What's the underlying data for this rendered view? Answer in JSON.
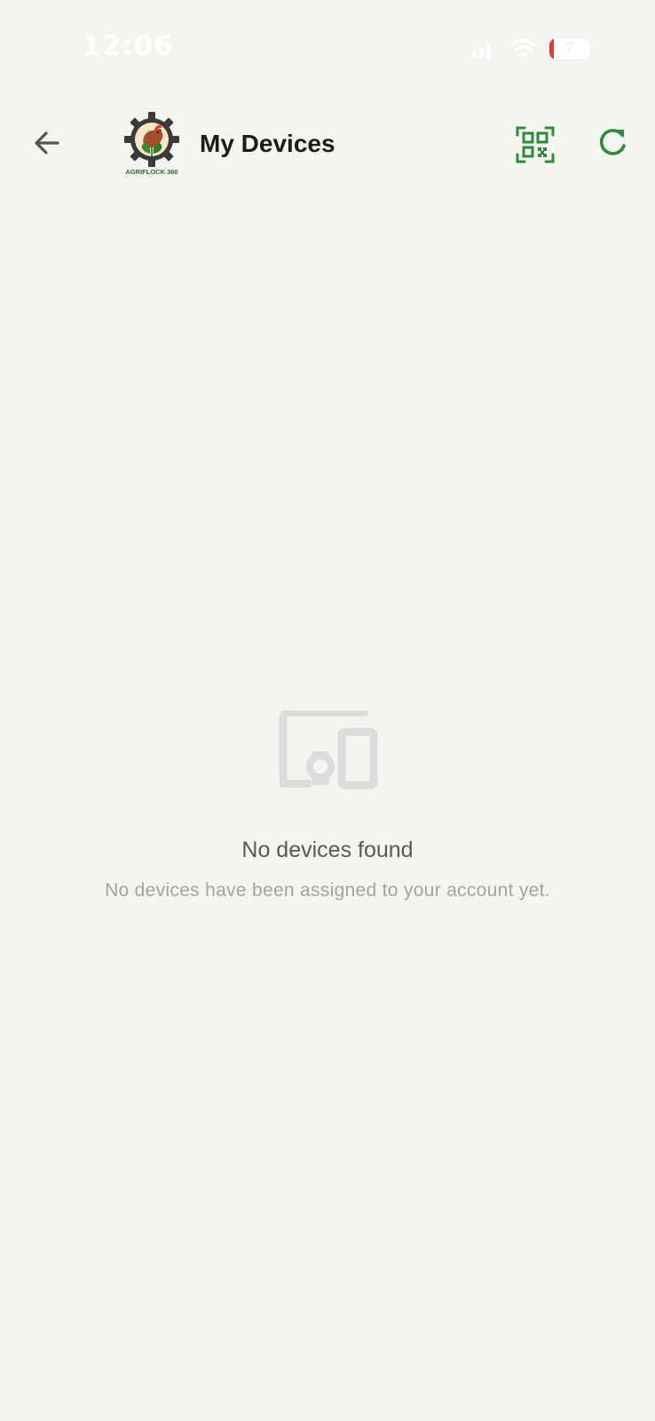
{
  "status_bar": {
    "time": "12:06",
    "battery_level": "7",
    "icons": [
      "signal-icon",
      "wifi-icon",
      "battery-icon"
    ]
  },
  "header": {
    "title": "My Devices",
    "logo_text": "AGRIFLOCK 360",
    "icons": [
      "back-arrow-icon",
      "qr-code-scan-icon",
      "refresh-icon"
    ],
    "accent_color": "#2e8b3c"
  },
  "empty_state": {
    "icon": "devices-icon",
    "title": "No devices found",
    "subtitle": "No devices have been assigned to your account yet."
  }
}
